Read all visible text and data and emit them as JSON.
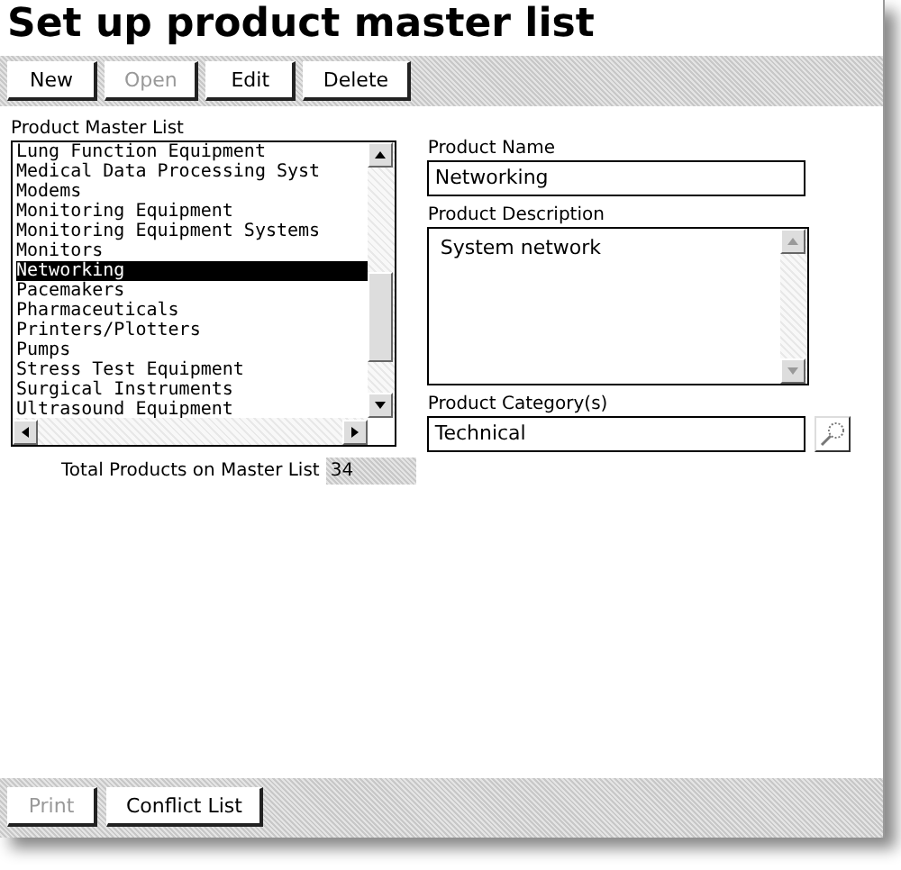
{
  "title": "Set up product master list",
  "toolbar": [
    {
      "label": "New",
      "disabled": false
    },
    {
      "label": "Open",
      "disabled": true
    },
    {
      "label": "Edit",
      "disabled": false
    },
    {
      "label": "Delete",
      "disabled": false
    }
  ],
  "master_list": {
    "label": "Product Master List",
    "items": [
      {
        "label": "Lung Function Equipment",
        "selected": false
      },
      {
        "label": "Medical Data Processing Syst",
        "selected": false
      },
      {
        "label": "Modems",
        "selected": false
      },
      {
        "label": "Monitoring Equipment",
        "selected": false
      },
      {
        "label": "Monitoring Equipment Systems",
        "selected": false
      },
      {
        "label": "Monitors",
        "selected": false
      },
      {
        "label": "Networking",
        "selected": true
      },
      {
        "label": "Pacemakers",
        "selected": false
      },
      {
        "label": "Pharmaceuticals",
        "selected": false
      },
      {
        "label": "Printers/Plotters",
        "selected": false
      },
      {
        "label": "Pumps",
        "selected": false
      },
      {
        "label": "Stress Test Equipment",
        "selected": false
      },
      {
        "label": "Surgical Instruments",
        "selected": false
      },
      {
        "label": "Ultrasound Equipment",
        "selected": false
      }
    ]
  },
  "total": {
    "label": "Total Products on Master List",
    "value": "34"
  },
  "product_name": {
    "label": "Product Name",
    "value": "Networking"
  },
  "product_description": {
    "label": "Product Description",
    "value": "System network"
  },
  "product_category": {
    "label": "Product Category(s)",
    "value": "Technical"
  },
  "footer": [
    {
      "label": "Print",
      "disabled": true
    },
    {
      "label": "Conflict List",
      "disabled": false
    }
  ]
}
